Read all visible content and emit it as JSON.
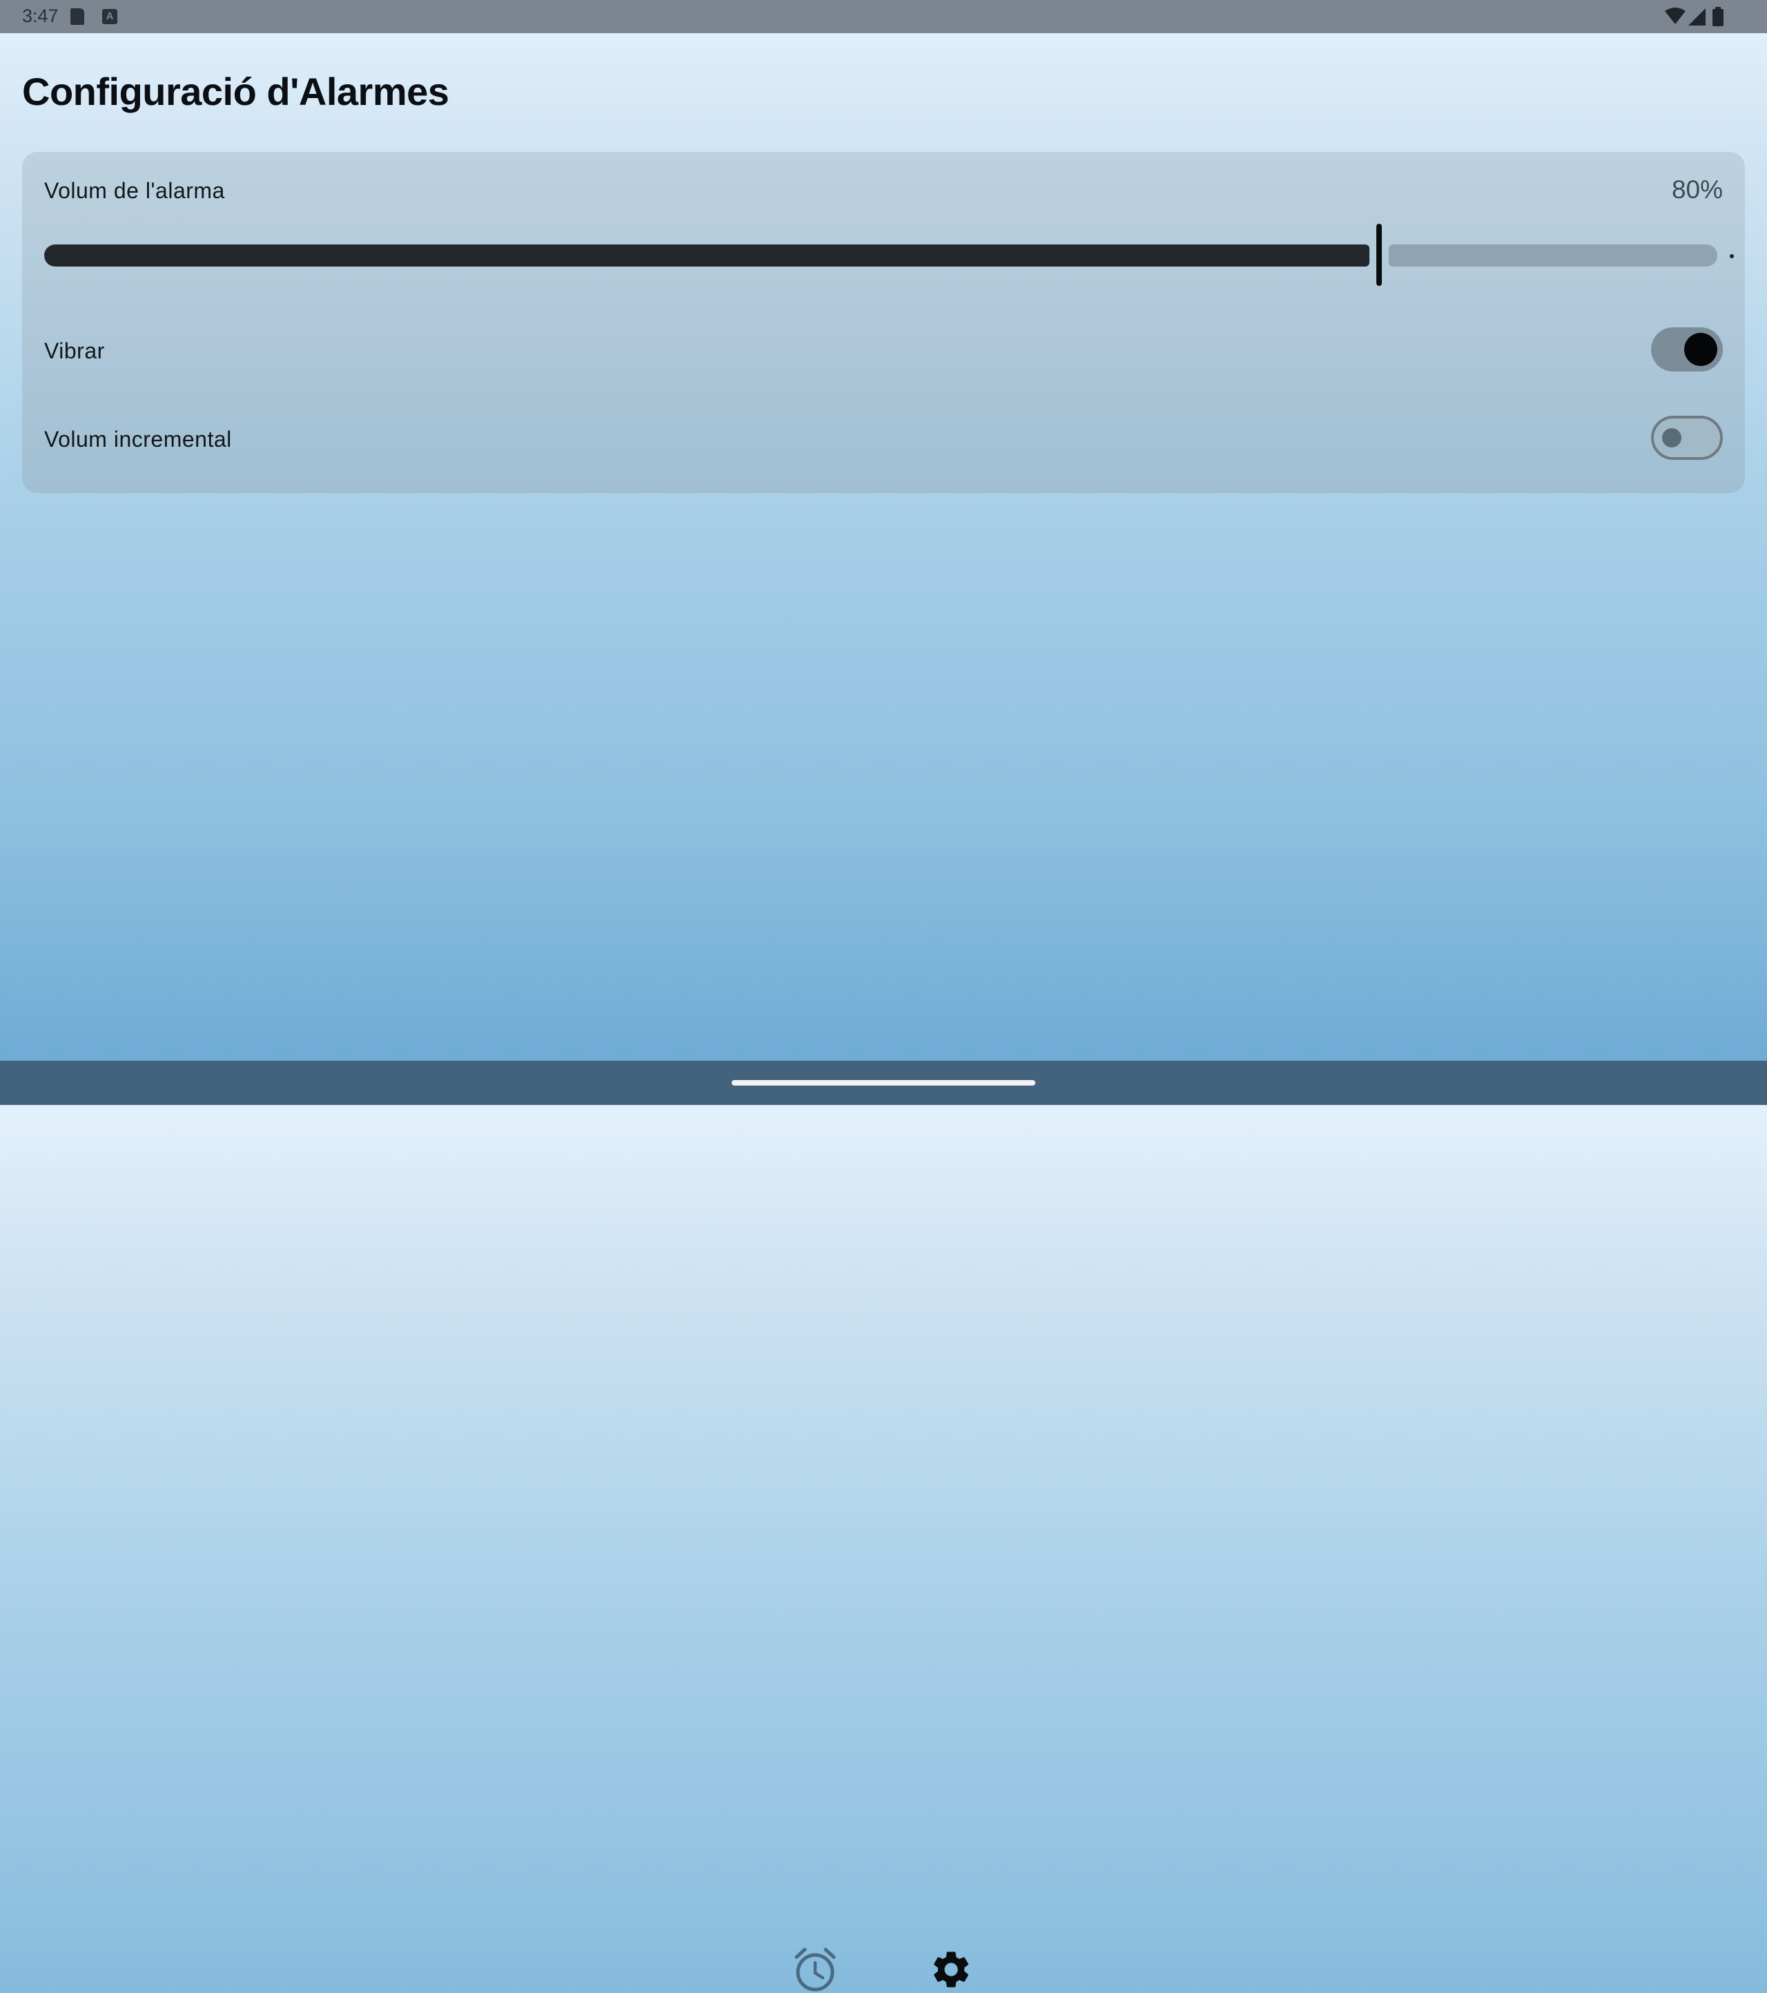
{
  "status_bar": {
    "time": "3:47",
    "icons": [
      "sd-card-icon",
      "keyboard-a-icon",
      "wifi-icon",
      "signal-icon",
      "battery-icon"
    ]
  },
  "page": {
    "title": "Configuració d'Alarmes"
  },
  "settings": {
    "volume_label": "Volum de l'alarma",
    "volume_value": "80%",
    "volume_fraction": 0.8,
    "vibrate_label": "Vibrar",
    "vibrate_on": true,
    "incremental_label": "Volum incremental",
    "incremental_on": false
  },
  "navigation": {
    "items": [
      {
        "icon": "alarm-clock-icon",
        "selected": false
      },
      {
        "icon": "gear-icon",
        "selected": true
      }
    ]
  },
  "colors": {
    "background_top": "#e3f1fc",
    "background_bottom": "#6aa7d3",
    "card": "#b4cad9",
    "slider_active": "#23282c",
    "slider_inactive": "#8fa3b0",
    "gesture_bar": "#43627b"
  }
}
